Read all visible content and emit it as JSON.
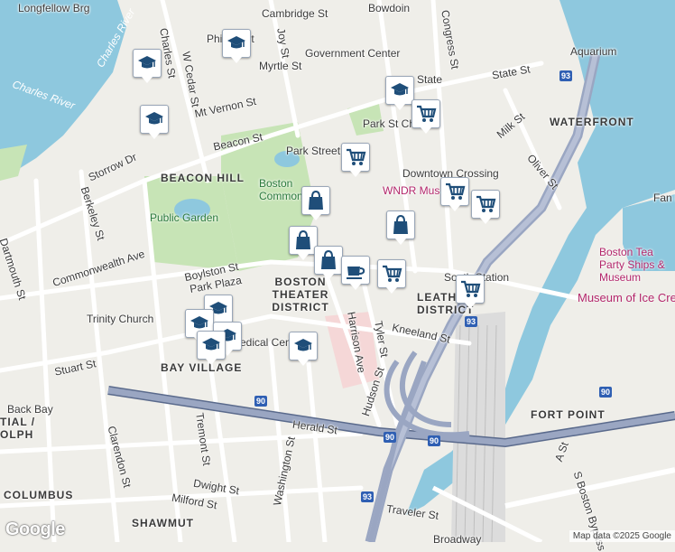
{
  "map": {
    "streets": [
      "Longfellow Brg",
      "Cambridge St",
      "Bowdoin",
      "Phillips St",
      "Myrtle St",
      "Joy St",
      "Charles St",
      "W Cedar St",
      "Mt Vernon St",
      "Government Center",
      "State",
      "State St",
      "Congress St",
      "Aquarium",
      "Milk St",
      "Beacon St",
      "Storrow Dr",
      "Park St Church",
      "Park Street",
      "Downtown Crossing",
      "WNDR Museum",
      "Berkeley St",
      "Dartmouth St",
      "Commonwealth Ave",
      "Boylston St",
      "Park Plaza",
      "Kneeland St",
      "South Station",
      "Harrison Ave",
      "Tyler St",
      "Hudson St",
      "Stuart St",
      "Back Bay",
      "Clarendon St",
      "Tremont St",
      "Washington St",
      "Herald St",
      "Dwight St",
      "Milford St",
      "Traveler St",
      "A St",
      "S Boston Bypass",
      "Oliver St",
      "Broadway",
      "Medical Center",
      "Charles River"
    ],
    "neighborhoods": [
      "WATERFRONT",
      "BEACON HILL",
      "BOSTON THEATER DISTRICT",
      "LEATHER DISTRICT",
      "BAY VILLAGE",
      "FORT POINT",
      "SHAWMUT",
      "COLUMBUS",
      "TIAL / OLPH"
    ],
    "pois": [
      "Boston Common",
      "Public Garden",
      "Trinity Church",
      "Boston Tea Party Ships & Museum",
      "Museum of Ice Cream",
      "Fan Pier"
    ],
    "highways": [
      "93",
      "90",
      "90",
      "93",
      "90",
      "93",
      "90"
    ],
    "markers": [
      {
        "kind": "school"
      },
      {
        "kind": "school"
      },
      {
        "kind": "school"
      },
      {
        "kind": "school"
      },
      {
        "kind": "cart"
      },
      {
        "kind": "cart"
      },
      {
        "kind": "cart"
      },
      {
        "kind": "cart"
      },
      {
        "kind": "bag"
      },
      {
        "kind": "bag"
      },
      {
        "kind": "bag"
      },
      {
        "kind": "bag"
      },
      {
        "kind": "cup"
      },
      {
        "kind": "cart"
      },
      {
        "kind": "cart"
      },
      {
        "kind": "school"
      },
      {
        "kind": "school"
      },
      {
        "kind": "school"
      },
      {
        "kind": "school"
      },
      {
        "kind": "school"
      }
    ],
    "footer": {
      "logo": "Google",
      "attribution": "Map data ©2025 Google"
    }
  },
  "colors": {
    "water": "#8ec8de",
    "park": "#c7e4b6",
    "highway": "#9aa6c2",
    "road": "#ffffff",
    "marker_icon": "#1f4e79",
    "interstate": "#2f5fb3",
    "land": "#efeee9"
  }
}
